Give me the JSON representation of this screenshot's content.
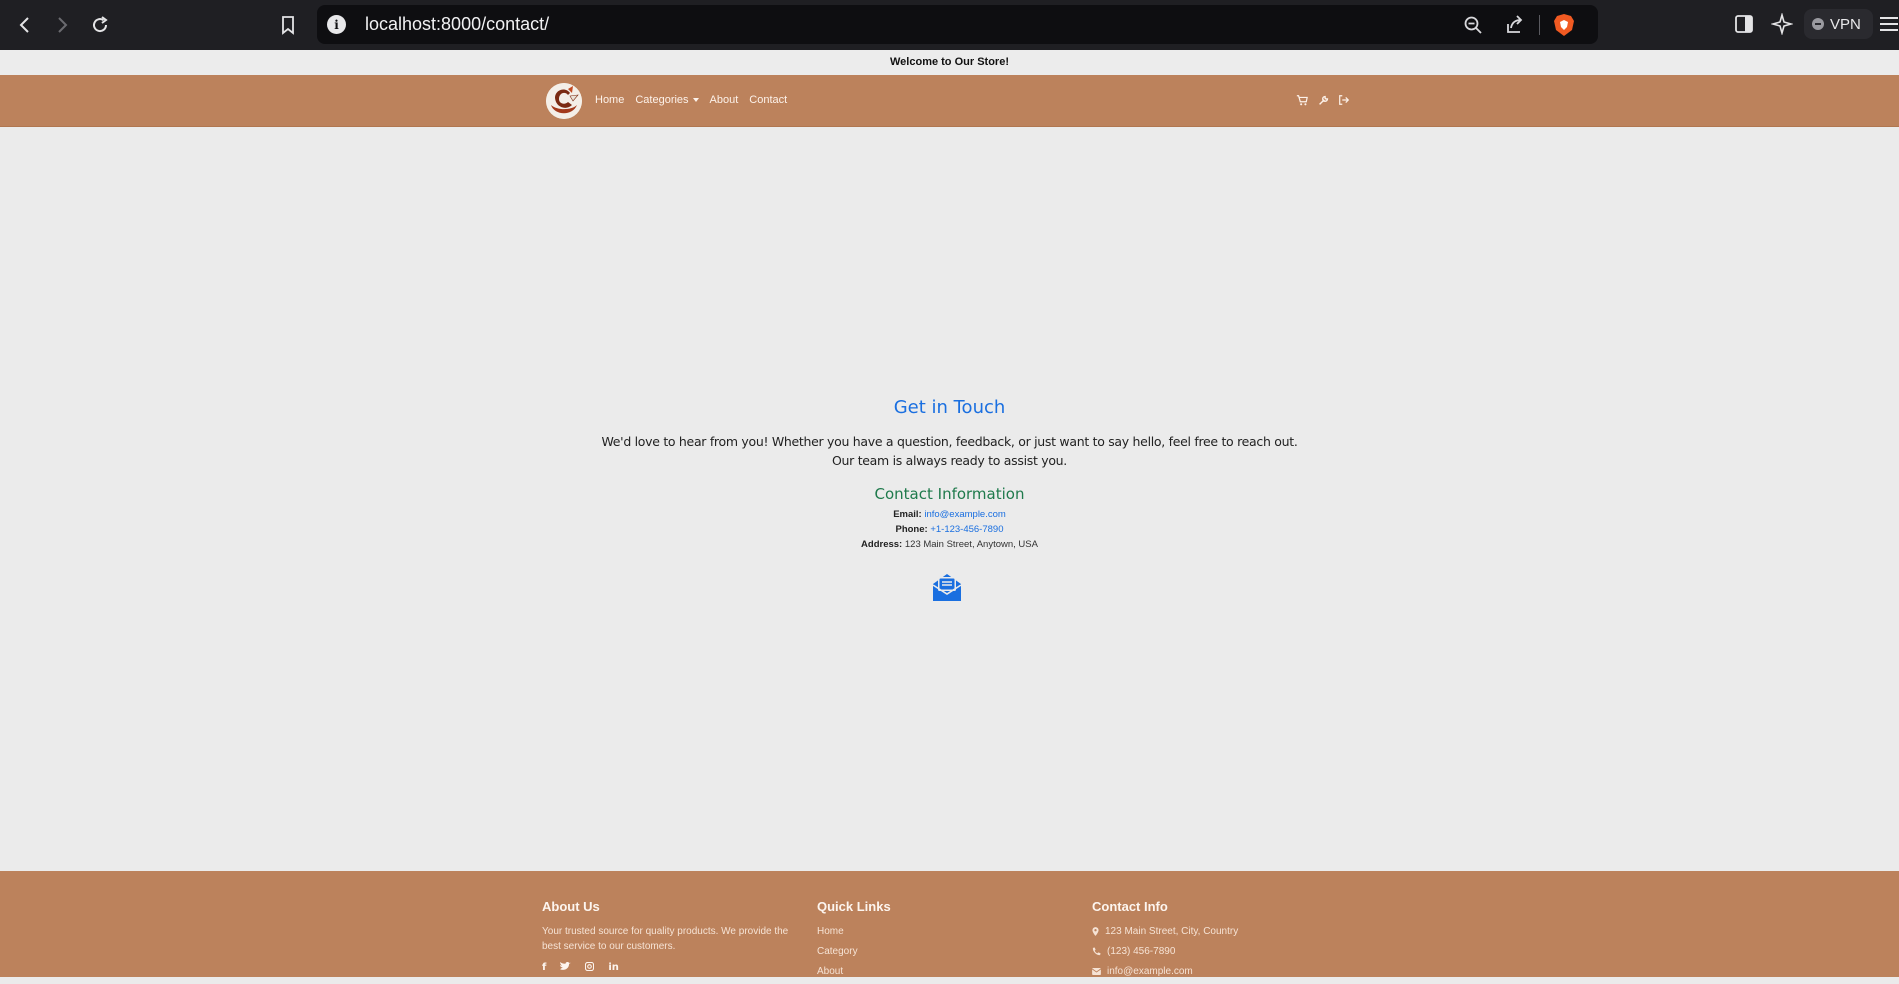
{
  "browser": {
    "url": "localhost:8000/contact/",
    "vpn_label": "VPN"
  },
  "site": {
    "welcome": "Welcome to Our Store!",
    "nav": {
      "home": "Home",
      "categories": "Categories",
      "about": "About",
      "contact": "Contact"
    }
  },
  "contact": {
    "title": "Get in Touch",
    "intro_line1": "We'd love to hear from you! Whether you have a question, feedback, or just want to say hello, feel free to reach out.",
    "intro_line2": "Our team is always ready to assist you.",
    "info_title": "Contact Information",
    "email_label": "Email:",
    "email": "info@example.com",
    "phone_label": "Phone:",
    "phone": "+1-123-456-7890",
    "address_label": "Address:",
    "address": "123 Main Street, Anytown, USA"
  },
  "footer": {
    "about": {
      "title": "About Us",
      "text": "Your trusted source for quality products. We provide the best service to our customers."
    },
    "links": {
      "title": "Quick Links",
      "items": [
        "Home",
        "Category",
        "About"
      ]
    },
    "contact": {
      "title": "Contact Info",
      "address": "123 Main Street, City, Country",
      "phone": "(123) 456-7890",
      "email": "info@example.com"
    }
  },
  "colors": {
    "brand": "#bc825c",
    "link_blue": "#1a6fe0",
    "green_heading": "#1f7a4c"
  }
}
